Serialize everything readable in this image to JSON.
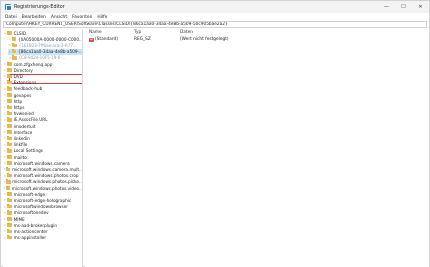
{
  "window": {
    "title": "Registrierungs-Editor",
    "controls": {
      "minimize": "—",
      "maximize": "☐",
      "close": "✕"
    }
  },
  "menu": [
    "Datei",
    "Bearbeiten",
    "Ansicht",
    "Favoriten",
    "Hilfe"
  ],
  "address": "Computer\\HKEY_CURRENT_USER\\Software\\Classes\\CLSID\\{86ca1aa0-34aa-4e8b-a509-50c905bae2a2}",
  "tree": [
    {
      "label": "CLSID",
      "expanded": true,
      "blurred": false
    },
    {
      "label": "{0A05000A-0000-0000-C000...",
      "blurred": false
    },
    {
      "label": "{1E1B23-7ff6ae-aca-3-R77...",
      "blurred": true
    },
    {
      "label": "{86ca1aa0-34aa-4e8b-a509-...",
      "blurred": false,
      "selected": true
    },
    {
      "label": "{C8-9424-10F5-19-6-...",
      "blurred": true
    },
    {
      "label": "com.zfgxhenq.app",
      "blurred": false
    },
    {
      "label": "Directory",
      "blurred": false
    },
    {
      "label": "DVD",
      "blurred": false
    },
    {
      "label": "Extensions",
      "blurred": false
    },
    {
      "label": "feedback-hub",
      "blurred": false
    },
    {
      "label": "gevapes",
      "blurred": false
    },
    {
      "label": "http",
      "blurred": false
    },
    {
      "label": "https",
      "blurred": false
    },
    {
      "label": "hvwenied",
      "blurred": false
    },
    {
      "label": "IE.AssocFile.URL",
      "blurred": false
    },
    {
      "label": "imodertuit",
      "blurred": false
    },
    {
      "label": "Interface",
      "blurred": false
    },
    {
      "label": "linkedin",
      "blurred": false
    },
    {
      "label": "linkfile",
      "blurred": false
    },
    {
      "label": "Local Settings",
      "blurred": false
    },
    {
      "label": "mailto",
      "blurred": false
    },
    {
      "label": "microsoft.windows.camera",
      "blurred": false
    },
    {
      "label": "microsoft.windows.camera.mult...",
      "blurred": false
    },
    {
      "label": "microsoft.windows.photos.crop",
      "blurred": false
    },
    {
      "label": "microsoft.windows.photos.picke...",
      "blurred": false
    },
    {
      "label": "microsoft.windows.photos.video...",
      "blurred": false
    },
    {
      "label": "microsoft-edge",
      "blurred": false
    },
    {
      "label": "microsoft-edge-holographic",
      "blurred": false
    },
    {
      "label": "microsoftwindowsbrowser",
      "blurred": false
    },
    {
      "label": "microsoftonedev",
      "blurred": false
    },
    {
      "label": "MIME",
      "blurred": false
    },
    {
      "label": "ms-aad-brokerplugin",
      "blurred": false
    },
    {
      "label": "ms-actioncenter",
      "blurred": false
    },
    {
      "label": "ms-appinstaller",
      "blurred": false
    }
  ],
  "columns": {
    "name": "Name",
    "type": "Typ",
    "data": "Daten"
  },
  "values": [
    {
      "icon": "ab",
      "name": "(Standard)",
      "type": "REG_SZ",
      "data": "(Wert nicht festgelegt)"
    }
  ]
}
